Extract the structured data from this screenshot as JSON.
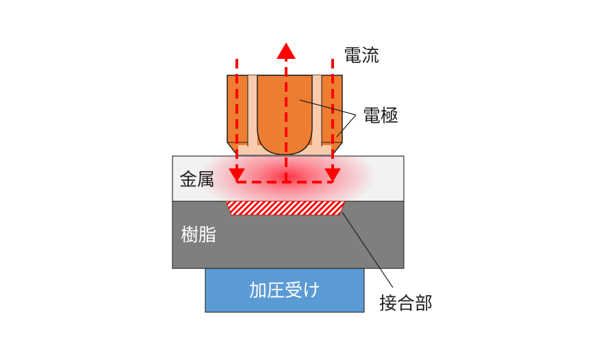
{
  "labels": {
    "current": "電流",
    "electrode": "電極",
    "metal": "金属",
    "resin": "樹脂",
    "pressure_support": "加圧受け",
    "joint": "接合部"
  },
  "colors": {
    "electrode_fill": "#ED7D31",
    "electrode_light": "#F8CBAD",
    "electrode_stroke": "#1F1F1F",
    "current_arrow": "#FF0000",
    "metal_fill": "#F2F2F2",
    "resin_fill": "#7F7F7F",
    "support_fill": "#5B9BD5",
    "joint_hatch": "#FF0000",
    "heat_glow": "#FF3344"
  }
}
